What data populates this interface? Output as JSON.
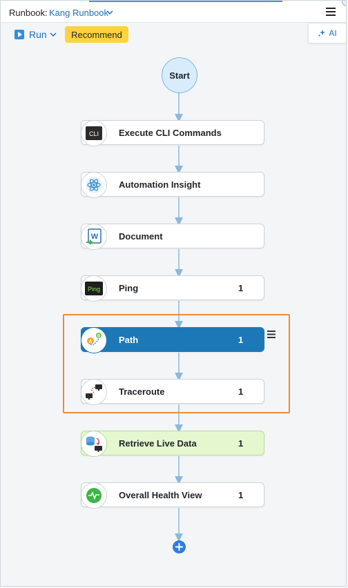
{
  "header": {
    "runbook_label": "Runbook:",
    "runbook_name": "Kang Runbook"
  },
  "toolbar": {
    "run_label": "Run",
    "recommend_label": "Recommend",
    "ai_label": "AI"
  },
  "flow": {
    "start_label": "Start",
    "nodes": [
      {
        "label": "Execute CLI Commands",
        "count": "",
        "icon": "cli-icon",
        "state": "normal"
      },
      {
        "label": "Automation Insight",
        "count": "",
        "icon": "atom-icon",
        "state": "normal"
      },
      {
        "label": "Document",
        "count": "",
        "icon": "word-document-icon",
        "state": "normal"
      },
      {
        "label": "Ping",
        "count": "1",
        "icon": "ping-icon",
        "state": "normal"
      },
      {
        "label": "Path",
        "count": "1",
        "icon": "path-ab-icon",
        "state": "selected"
      },
      {
        "label": "Traceroute",
        "count": "1",
        "icon": "traceroute-icon",
        "state": "normal"
      },
      {
        "label": "Retrieve Live Data",
        "count": "1",
        "icon": "live-data-icon",
        "state": "live"
      },
      {
        "label": "Overall Health View",
        "count": "1",
        "icon": "health-pulse-icon",
        "state": "normal"
      }
    ]
  },
  "colors": {
    "accent": "#1e6fb8",
    "selected_node": "#1d78b8",
    "recommend": "#ffd23f",
    "live_node": "#e5f7cf",
    "highlight": "#f28a30",
    "connector": "#8ab8de"
  }
}
